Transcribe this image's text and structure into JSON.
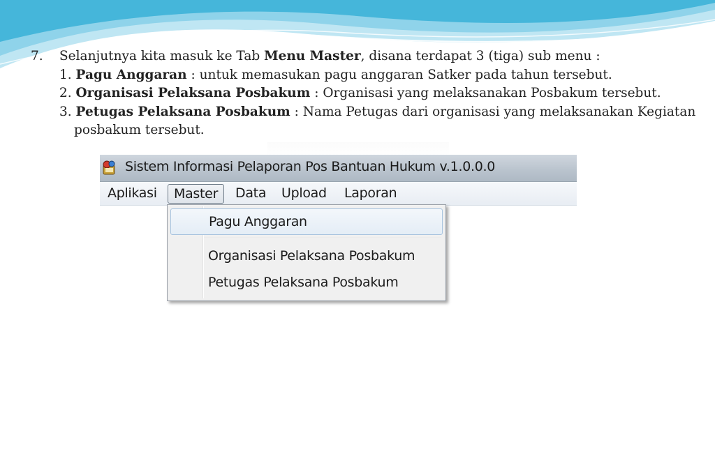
{
  "instruction": {
    "number": "7.",
    "intro_pre": "Selanjutnya kita masuk ke Tab ",
    "intro_bold": "Menu Master",
    "intro_post": ", disana terdapat 3 (tiga) sub menu :",
    "items": [
      {
        "num": "1.",
        "bold": "Pagu Anggaran",
        "text": " : untuk memasukan pagu anggaran Satker pada tahun tersebut."
      },
      {
        "num": "2.",
        "bold": "Organisasi Pelaksana Posbakum",
        "text": " : Organisasi yang melaksanakan Posbakum tersebut."
      },
      {
        "num": "3.",
        "bold": "Petugas Pelaksana Posbakum",
        "text": " :  Nama Petugas dari organisasi yang melaksanakan Kegiatan"
      }
    ],
    "continuation": "posbakum tersebut."
  },
  "app": {
    "title": "Sistem Informasi Pelaporan Pos Bantuan Hukum v.1.0.0.0",
    "icon": "app-logo-icon",
    "menu": [
      "Aplikasi",
      "Master",
      "Data",
      "Upload",
      "Laporan"
    ],
    "active_menu": "Master",
    "dropdown": [
      "Pagu Anggaran",
      "Organisasi Pelaksana Posbakum",
      "Petugas Pelaksana Posbakum"
    ],
    "highlighted_item": "Pagu Anggaran"
  },
  "colors": {
    "wave_light": "#bfe6f3",
    "wave_mid": "#7fcde6",
    "wave_dark": "#35aed4",
    "titlebar": "#b9c3cd",
    "dropdown_bg": "#f0f0f0",
    "highlight_border": "#a8c4df"
  }
}
